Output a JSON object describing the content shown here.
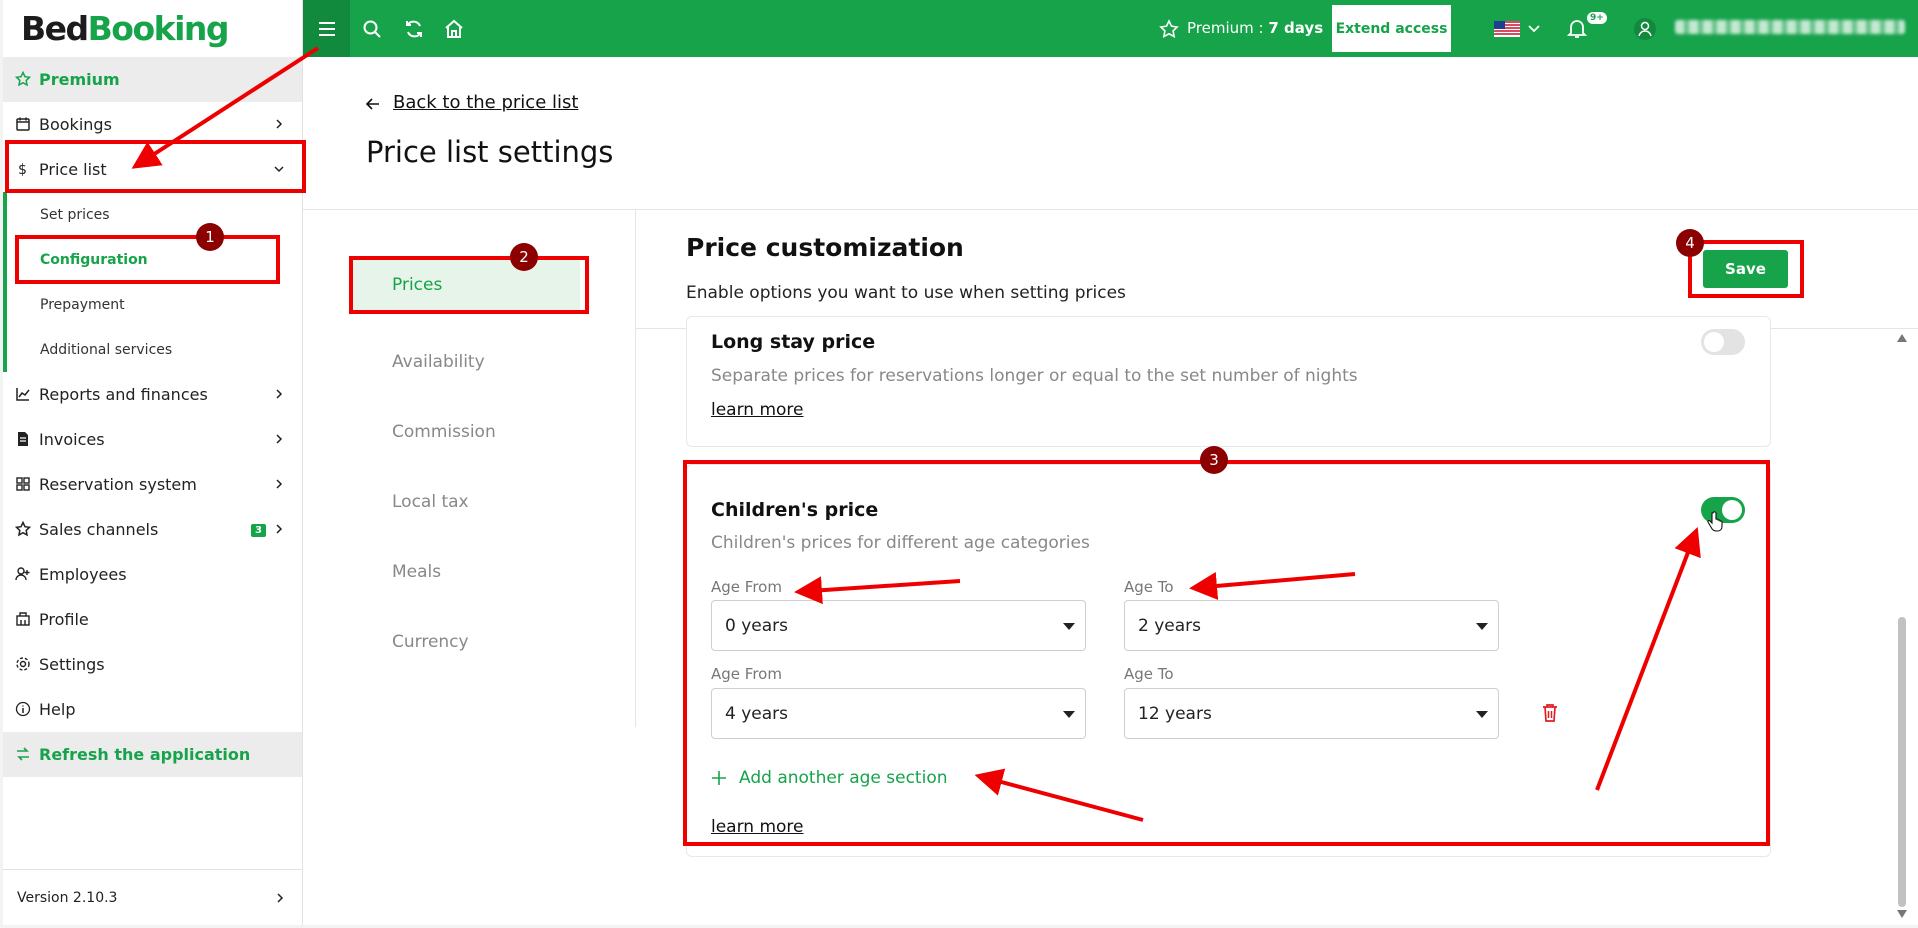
{
  "logo": {
    "part1": "Bed",
    "part2": "Booking"
  },
  "sidebar": {
    "premium": "Premium",
    "bookings": "Bookings",
    "price_list": "Price list",
    "sub": {
      "set_prices": "Set prices",
      "configuration": "Configuration",
      "prepayment": "Prepayment",
      "additional": "Additional services"
    },
    "reports": "Reports and finances",
    "invoices": "Invoices",
    "reservation": "Reservation system",
    "sales": "Sales channels",
    "sales_badge": "3",
    "employees": "Employees",
    "profile": "Profile",
    "settings": "Settings",
    "help": "Help",
    "refresh": "Refresh the application",
    "version": "Version 2.10.3"
  },
  "topbar": {
    "premium_label": "Premium :",
    "premium_days": "7 days",
    "extend": "Extend access",
    "notif_badge": "9+"
  },
  "main": {
    "back": "Back to the price list",
    "title": "Price list settings",
    "tabs": [
      "Prices",
      "Availability",
      "Commission",
      "Local tax",
      "Meals",
      "Currency"
    ],
    "section_title": "Price customization",
    "section_sub": "Enable options you want to use when setting prices",
    "save": "Save",
    "long_stay": {
      "title": "Long stay price",
      "desc": "Separate prices for reservations longer or equal to the set number of nights",
      "learn": "learn more",
      "enabled": false
    },
    "children": {
      "title": "Children's price",
      "desc": "Children's prices for different age categories",
      "enabled": true,
      "label_from": "Age From",
      "label_to": "Age To",
      "rows": [
        {
          "from": "0 years",
          "to": "2 years"
        },
        {
          "from": "4 years",
          "to": "12 years"
        }
      ],
      "add": "Add another age section",
      "learn": "learn more"
    }
  },
  "annotations": [
    "1",
    "2",
    "3",
    "4"
  ],
  "colors": {
    "accent": "#16a34a",
    "annotation": "#e00000",
    "marker": "#8b0000"
  }
}
